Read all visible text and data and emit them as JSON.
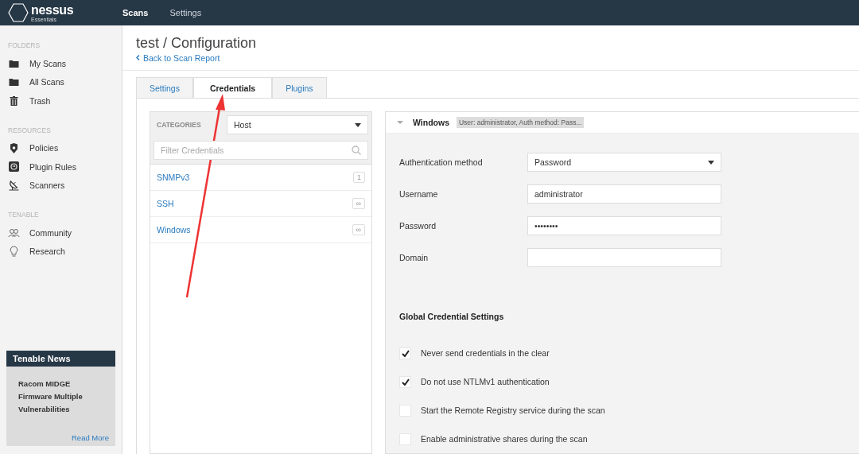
{
  "topbar": {
    "logo": {
      "name": "nessus",
      "edition": "Essentials"
    },
    "nav": [
      {
        "label": "Scans",
        "selected": true
      },
      {
        "label": "Settings",
        "selected": false
      }
    ]
  },
  "sidebar": {
    "sections": [
      {
        "title": "FOLDERS",
        "items": [
          {
            "label": "My Scans",
            "kind": "folder"
          },
          {
            "label": "All Scans",
            "kind": "folder"
          },
          {
            "label": "Trash",
            "kind": "trash"
          }
        ]
      },
      {
        "title": "RESOURCES",
        "items": [
          {
            "label": "Policies",
            "kind": "shield"
          },
          {
            "label": "Plugin Rules",
            "kind": "plugin"
          },
          {
            "label": "Scanners",
            "kind": "scanner"
          }
        ]
      },
      {
        "title": "TENABLE",
        "items": [
          {
            "label": "Community",
            "kind": "community"
          },
          {
            "label": "Research",
            "kind": "research"
          }
        ]
      }
    ],
    "news": {
      "title": "Tenable News",
      "headline": "Racom MIDGE Firmware Multiple Vulnerabilities",
      "link": "Read More"
    }
  },
  "page": {
    "title": "test / Configuration",
    "back_link": "Back to Scan Report"
  },
  "tabs": [
    {
      "label": "Settings",
      "selected": false
    },
    {
      "label": "Credentials",
      "selected": true
    },
    {
      "label": "Plugins",
      "selected": false
    }
  ],
  "categories": {
    "label": "CATEGORIES",
    "value": "Host",
    "filter_placeholder": "Filter Credentials",
    "items": [
      {
        "label": "SNMPv3",
        "count": "1"
      },
      {
        "label": "SSH",
        "count": "∞"
      },
      {
        "label": "Windows",
        "count": "∞"
      }
    ]
  },
  "credential": {
    "title": "Windows",
    "expanded": true,
    "summary": "User: administrator, Auth method: Pass...",
    "fields": [
      {
        "label": "Authentication method",
        "kind": "select",
        "value": "Password"
      },
      {
        "label": "Username",
        "kind": "text",
        "value": "administrator"
      },
      {
        "label": "Password",
        "kind": "text",
        "value": "••••••••"
      },
      {
        "label": "Domain",
        "kind": "text"
      }
    ],
    "global_title": "Global Credential Settings",
    "options": [
      {
        "label": "Never send credentials in the clear",
        "checked": true
      },
      {
        "label": "Do not use NTLMv1 authentication",
        "checked": true
      },
      {
        "label": "Start the Remote Registry service during the scan",
        "checked": false
      },
      {
        "label": "Enable administrative shares during the scan",
        "checked": false
      }
    ]
  },
  "annotation": {
    "kind": "arrow"
  }
}
